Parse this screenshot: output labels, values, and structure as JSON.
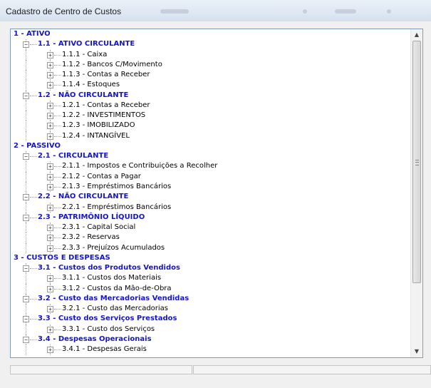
{
  "window": {
    "title": "Cadastro de Centro de Custos"
  },
  "icons": {
    "expander": "plus-box-icon",
    "collapser": "minus-box-icon",
    "scroll_up": "scroll-up-arrow-icon",
    "scroll_down": "scroll-down-arrow-icon"
  },
  "colors": {
    "group_text": "#1515c8",
    "account_text": "#000000"
  },
  "tree": {
    "rows": [
      {
        "level": 0,
        "label": "1 - ATIVO",
        "bold": true,
        "toggle": "none"
      },
      {
        "level": 1,
        "label": "1.1 - ATIVO CIRCULANTE",
        "bold": true,
        "toggle": "minus"
      },
      {
        "level": 2,
        "label": "1.1.1 - Caixa",
        "bold": false,
        "toggle": "plus"
      },
      {
        "level": 2,
        "label": "1.1.2 - Bancos C/Movimento",
        "bold": false,
        "toggle": "plus"
      },
      {
        "level": 2,
        "label": "1.1.3 - Contas a Receber",
        "bold": false,
        "toggle": "plus"
      },
      {
        "level": 2,
        "label": "1.1.4 - Estoques",
        "bold": false,
        "toggle": "plus"
      },
      {
        "level": 1,
        "label": "1.2 - NÃO CIRCULANTE",
        "bold": true,
        "toggle": "minus"
      },
      {
        "level": 2,
        "label": "1.2.1 - Contas a Receber",
        "bold": false,
        "toggle": "plus"
      },
      {
        "level": 2,
        "label": "1.2.2 - INVESTIMENTOS",
        "bold": false,
        "toggle": "plus"
      },
      {
        "level": 2,
        "label": "1.2.3 - IMOBILIZADO",
        "bold": false,
        "toggle": "plus"
      },
      {
        "level": 2,
        "label": "1.2.4 - INTANGÍVEL",
        "bold": false,
        "toggle": "plus"
      },
      {
        "level": 0,
        "label": "2 - PASSIVO",
        "bold": true,
        "toggle": "none"
      },
      {
        "level": 1,
        "label": "2.1 - CIRCULANTE",
        "bold": true,
        "toggle": "minus"
      },
      {
        "level": 2,
        "label": "2.1.1 - Impostos e Contribuições a Recolher",
        "bold": false,
        "toggle": "plus"
      },
      {
        "level": 2,
        "label": "2.1.2 - Contas a Pagar",
        "bold": false,
        "toggle": "plus"
      },
      {
        "level": 2,
        "label": "2.1.3 - Empréstimos Bancários",
        "bold": false,
        "toggle": "plus"
      },
      {
        "level": 1,
        "label": "2.2 - NÃO CIRCULANTE",
        "bold": true,
        "toggle": "minus"
      },
      {
        "level": 2,
        "label": "2.2.1 - Empréstimos Bancários",
        "bold": false,
        "toggle": "plus"
      },
      {
        "level": 1,
        "label": "2.3 - PATRIMÔNIO LÍQUIDO",
        "bold": true,
        "toggle": "minus"
      },
      {
        "level": 2,
        "label": "2.3.1 - Capital Social",
        "bold": false,
        "toggle": "plus"
      },
      {
        "level": 2,
        "label": "2.3.2 - Reservas",
        "bold": false,
        "toggle": "plus"
      },
      {
        "level": 2,
        "label": "2.3.3 - Prejuízos Acumulados",
        "bold": false,
        "toggle": "plus"
      },
      {
        "level": 0,
        "label": "3 - CUSTOS E DESPESAS",
        "bold": true,
        "toggle": "none"
      },
      {
        "level": 1,
        "label": "3.1 - Custos dos Produtos Vendidos",
        "bold": true,
        "toggle": "minus"
      },
      {
        "level": 2,
        "label": "3.1.1 - Custos dos Materiais",
        "bold": false,
        "toggle": "plus"
      },
      {
        "level": 2,
        "label": "3.1.2 - Custos da Mão-de-Obra",
        "bold": false,
        "toggle": "plus"
      },
      {
        "level": 1,
        "label": "3.2 - Custo das Mercadorias Vendidas",
        "bold": true,
        "toggle": "minus"
      },
      {
        "level": 2,
        "label": "3.2.1 - Custo das Mercadorias",
        "bold": false,
        "toggle": "plus"
      },
      {
        "level": 1,
        "label": "3.3 - Custo dos Serviços Prestados",
        "bold": true,
        "toggle": "minus"
      },
      {
        "level": 2,
        "label": "3.3.1 - Custo dos Serviços",
        "bold": false,
        "toggle": "plus"
      },
      {
        "level": 1,
        "label": "3.4 - Despesas Operacionais",
        "bold": true,
        "toggle": "minus"
      },
      {
        "level": 2,
        "label": "3.4.1 - Despesas Gerais",
        "bold": false,
        "toggle": "plus"
      }
    ]
  },
  "statusbar": {
    "panels": [
      "",
      ""
    ]
  }
}
